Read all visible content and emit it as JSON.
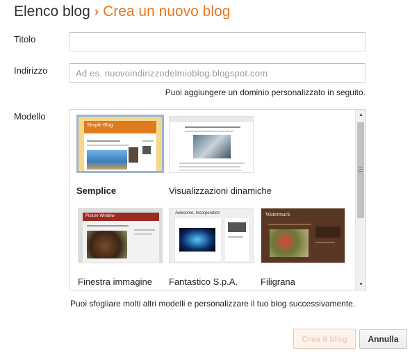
{
  "header": {
    "breadcrumb": "Elenco blog",
    "separator": "›",
    "title": "Crea un nuovo blog"
  },
  "form": {
    "title_label": "Titolo",
    "title_value": "",
    "address_label": "Indirizzo",
    "address_placeholder": "Ad es. nuovoindirizzodelmioblog.blogspot.com",
    "address_hint": "Puoi aggiungere un dominio personalizzato in seguito.",
    "template_label": "Modello",
    "template_hint": "Puoi sfogliare molti altri modelli e personalizzare il tuo blog successivamente."
  },
  "templates": [
    {
      "name": "Semplice",
      "selected": true,
      "thumb_title": "Simple Blog"
    },
    {
      "name": "Visualizzazioni dinamiche",
      "selected": false,
      "thumb_title": ""
    },
    {
      "name": "Finestra immagine",
      "selected": false,
      "thumb_title": "Picture Window"
    },
    {
      "name": "Fantastico S.p.A.",
      "selected": false,
      "thumb_title": "Awesome, Incorporation"
    },
    {
      "name": "Filigrana",
      "selected": false,
      "thumb_title": "Watermark"
    }
  ],
  "buttons": {
    "create": "Crea il blog",
    "cancel": "Annulla"
  },
  "colors": {
    "accent": "#e8761e",
    "selected_border": "#9cb4d8"
  },
  "icons": {
    "scroll_up": "triangle-up-icon",
    "scroll_down": "triangle-down-icon"
  }
}
